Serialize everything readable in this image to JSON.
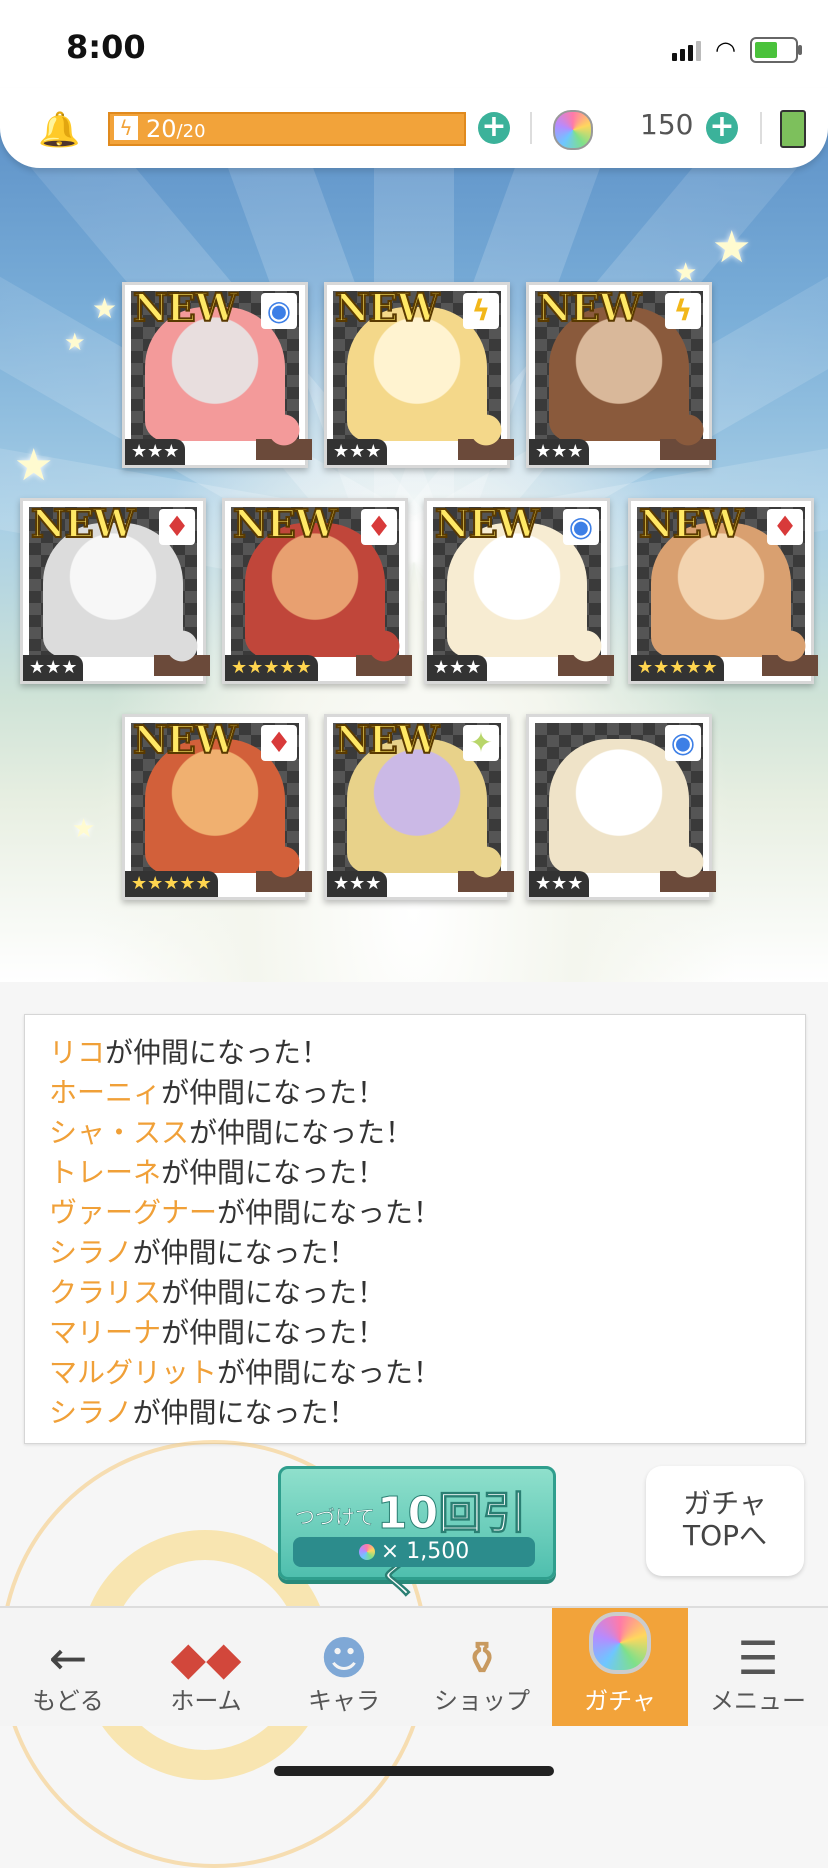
{
  "status_bar": {
    "time": "8:00"
  },
  "resources": {
    "stamina_current": "20",
    "stamina_max": "20",
    "gems": "150"
  },
  "cards": [
    {
      "new": "NEW",
      "attr": "circle",
      "stars": "★★★",
      "gold": false
    },
    {
      "new": "NEW",
      "attr": "bolt",
      "stars": "★★★",
      "gold": false
    },
    {
      "new": "NEW",
      "attr": "bolt",
      "stars": "★★★",
      "gold": false
    },
    {
      "new": "NEW",
      "attr": "diamond",
      "stars": "★★★",
      "gold": false
    },
    {
      "new": "NEW",
      "attr": "diamond",
      "stars": "★★★★★",
      "gold": true
    },
    {
      "new": "NEW",
      "attr": "circle",
      "stars": "★★★",
      "gold": false
    },
    {
      "new": "NEW",
      "attr": "diamond",
      "stars": "★★★★★",
      "gold": true
    },
    {
      "new": "NEW",
      "attr": "diamond",
      "stars": "★★★★★",
      "gold": true
    },
    {
      "new": "NEW",
      "attr": "sparkle",
      "stars": "★★★",
      "gold": false
    },
    {
      "new": "",
      "attr": "circle",
      "stars": "★★★",
      "gold": false
    }
  ],
  "log": {
    "suffix": "が仲間になった！",
    "names": [
      "リコ",
      "ホーニィ",
      "シャ・スス",
      "トレーネ",
      "ヴァーグナー",
      "シラノ",
      "クラリス",
      "マリーナ",
      "マルグリット",
      "シラノ"
    ]
  },
  "pull_button": {
    "prefix": "つづけて",
    "label": "10回引く",
    "cost": "× 1,500"
  },
  "gacha_top": {
    "line1": "ガチャ",
    "line2": "TOPへ"
  },
  "nav": [
    {
      "label": "もどる",
      "icon": "back-arrow-icon"
    },
    {
      "label": "ホーム",
      "icon": "home-icon"
    },
    {
      "label": "キャラ",
      "icon": "character-icon"
    },
    {
      "label": "ショップ",
      "icon": "shop-icon"
    },
    {
      "label": "ガチャ",
      "icon": "gacha-orb-icon"
    },
    {
      "label": "メニュー",
      "icon": "menu-list-icon"
    }
  ],
  "colors": {
    "accent": "#f2a33a",
    "teal": "#3bb29a",
    "name_orange": "#f0a038"
  }
}
